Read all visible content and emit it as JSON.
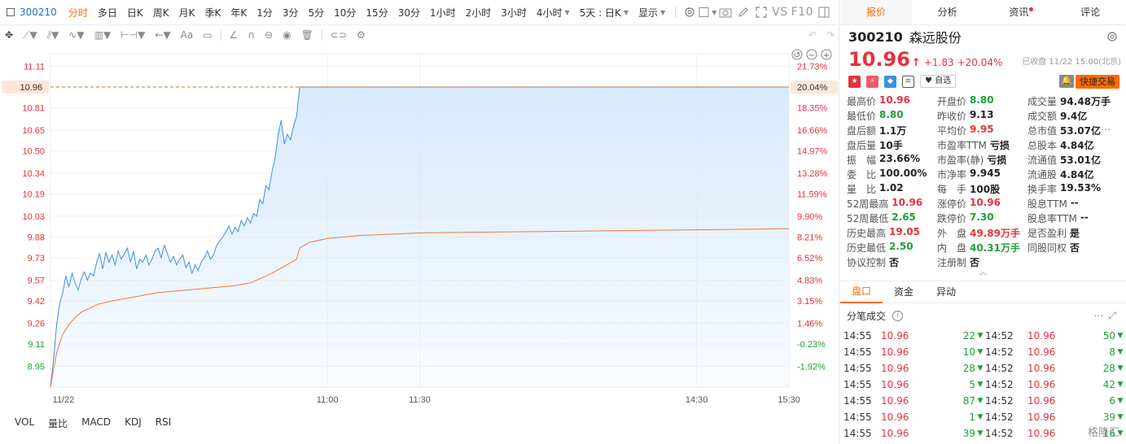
{
  "toolbar": {
    "code": "300210",
    "periods": [
      "分时",
      "多日",
      "日K",
      "周K",
      "月K",
      "季K",
      "年K",
      "1分",
      "3分",
      "5分",
      "10分",
      "15分",
      "30分",
      "1小时",
      "2小时",
      "3小时",
      "4小时"
    ],
    "active_period": "分时",
    "dropdown_period": "4小时",
    "five_day": "5天 : 日K",
    "display": "显示",
    "vs": "VS",
    "f10": "F10"
  },
  "drawtools": {
    "text_label": "Aa"
  },
  "chart_data": {
    "type": "line",
    "subtype": "intraday",
    "prev_close": 9.13,
    "limit_price": 10.96,
    "y_ticks": [
      11.11,
      10.96,
      10.81,
      10.65,
      10.5,
      10.34,
      10.19,
      10.03,
      9.88,
      9.73,
      9.57,
      9.42,
      9.26,
      9.11,
      8.95
    ],
    "y_tick_labels": [
      "11.11",
      "10.96",
      "10.81",
      "10.65",
      "10.50",
      "10.34",
      "10.19",
      "10.03",
      "9.88",
      "9.73",
      "9.57",
      "9.42",
      "9.26",
      "9.11",
      "8.95"
    ],
    "pct_ticks": [
      "21.73%",
      "20.04%",
      "18.35%",
      "16.66%",
      "14.97%",
      "13.28%",
      "11.59%",
      "9.90%",
      "8.21%",
      "6.52%",
      "4.83%",
      "3.15%",
      "1.46%",
      "-0.23%",
      "-1.92%"
    ],
    "highlight_label": "10.96",
    "highlight_pct": "20.04%",
    "ylim": [
      8.8,
      11.2
    ],
    "x_labels": [
      {
        "t": 0,
        "label": "11/22"
      },
      {
        "t": 90,
        "label": "11:00"
      },
      {
        "t": 120,
        "label": "11:30"
      },
      {
        "t": 210,
        "label": "14:30"
      },
      {
        "t": 240,
        "label": "15:30"
      }
    ],
    "x_range": [
      0,
      240
    ],
    "price_series": [
      [
        0,
        8.8
      ],
      [
        1,
        9.0
      ],
      [
        2,
        9.25
      ],
      [
        3,
        9.4
      ],
      [
        4,
        9.48
      ],
      [
        5,
        9.6
      ],
      [
        6,
        9.52
      ],
      [
        7,
        9.62
      ],
      [
        8,
        9.55
      ],
      [
        9,
        9.5
      ],
      [
        10,
        9.58
      ],
      [
        11,
        9.63
      ],
      [
        12,
        9.57
      ],
      [
        13,
        9.62
      ],
      [
        14,
        9.6
      ],
      [
        15,
        9.7
      ],
      [
        16,
        9.76
      ],
      [
        17,
        9.65
      ],
      [
        18,
        9.77
      ],
      [
        19,
        9.7
      ],
      [
        20,
        9.75
      ],
      [
        21,
        9.68
      ],
      [
        22,
        9.78
      ],
      [
        23,
        9.72
      ],
      [
        24,
        9.76
      ],
      [
        25,
        9.8
      ],
      [
        26,
        9.7
      ],
      [
        27,
        9.78
      ],
      [
        28,
        9.65
      ],
      [
        29,
        9.72
      ],
      [
        30,
        9.7
      ],
      [
        31,
        9.75
      ],
      [
        32,
        9.68
      ],
      [
        33,
        9.72
      ],
      [
        34,
        9.78
      ],
      [
        35,
        9.8
      ],
      [
        36,
        9.73
      ],
      [
        37,
        9.82
      ],
      [
        38,
        9.76
      ],
      [
        39,
        9.7
      ],
      [
        40,
        9.74
      ],
      [
        41,
        9.68
      ],
      [
        42,
        9.72
      ],
      [
        43,
        9.75
      ],
      [
        44,
        9.66
      ],
      [
        45,
        9.7
      ],
      [
        46,
        9.62
      ],
      [
        47,
        9.68
      ],
      [
        48,
        9.64
      ],
      [
        49,
        9.7
      ],
      [
        50,
        9.73
      ],
      [
        51,
        9.78
      ],
      [
        52,
        9.72
      ],
      [
        53,
        9.75
      ],
      [
        54,
        9.82
      ],
      [
        55,
        9.85
      ],
      [
        56,
        9.88
      ],
      [
        57,
        9.92
      ],
      [
        58,
        9.96
      ],
      [
        59,
        9.9
      ],
      [
        60,
        9.95
      ],
      [
        61,
        9.92
      ],
      [
        62,
        10.0
      ],
      [
        63,
        9.96
      ],
      [
        64,
        10.02
      ],
      [
        65,
        9.98
      ],
      [
        66,
        10.05
      ],
      [
        67,
        10.03
      ],
      [
        68,
        10.15
      ],
      [
        69,
        10.12
      ],
      [
        70,
        10.25
      ],
      [
        71,
        10.22
      ],
      [
        72,
        10.35
      ],
      [
        73,
        10.45
      ],
      [
        74,
        10.62
      ],
      [
        75,
        10.72
      ],
      [
        76,
        10.55
      ],
      [
        77,
        10.62
      ],
      [
        78,
        10.58
      ],
      [
        79,
        10.68
      ],
      [
        80,
        10.75
      ],
      [
        81,
        10.96
      ],
      [
        240,
        10.96
      ]
    ],
    "avg_series": [
      [
        0,
        8.8
      ],
      [
        2,
        9.05
      ],
      [
        4,
        9.18
      ],
      [
        6,
        9.25
      ],
      [
        8,
        9.3
      ],
      [
        10,
        9.34
      ],
      [
        13,
        9.37
      ],
      [
        16,
        9.4
      ],
      [
        20,
        9.42
      ],
      [
        25,
        9.44
      ],
      [
        30,
        9.46
      ],
      [
        35,
        9.48
      ],
      [
        40,
        9.49
      ],
      [
        45,
        9.5
      ],
      [
        50,
        9.51
      ],
      [
        55,
        9.52
      ],
      [
        60,
        9.53
      ],
      [
        65,
        9.55
      ],
      [
        68,
        9.58
      ],
      [
        72,
        9.62
      ],
      [
        76,
        9.67
      ],
      [
        80,
        9.72
      ],
      [
        81,
        9.8
      ],
      [
        84,
        9.84
      ],
      [
        90,
        9.87
      ],
      [
        100,
        9.89
      ],
      [
        120,
        9.91
      ],
      [
        160,
        9.92
      ],
      [
        200,
        9.93
      ],
      [
        240,
        9.94
      ]
    ],
    "colors": {
      "price_line": "#3d8fe6",
      "area_fill": "#d6e8fb",
      "avg_line": "#f07a3a",
      "up": "#e5323d",
      "down": "#1aa23b",
      "highlight": "#ff6a00"
    }
  },
  "indicators": [
    "VOL",
    "量比",
    "MACD",
    "KDJ",
    "RSI"
  ],
  "panel": {
    "tabs": [
      "报价",
      "分析",
      "资讯",
      "评论"
    ],
    "active_tab": "报价",
    "code": "300210",
    "name": "森远股份",
    "price": "10.96",
    "change": "+1.83",
    "change_pct": "+20.04%",
    "status": "已收盘 11/22 15:00(北京)",
    "zixuan": "自选",
    "quick_trade": "快捷交易",
    "stats": [
      [
        {
          "k": "最高价",
          "v": "10.96",
          "c": "red"
        },
        {
          "k": "开盘价",
          "v": "8.80",
          "c": "green"
        },
        {
          "k": "成交量",
          "v": "94.48万手",
          "c": ""
        }
      ],
      [
        {
          "k": "最低价",
          "v": "8.80",
          "c": "green"
        },
        {
          "k": "昨收价",
          "v": "9.13",
          "c": ""
        },
        {
          "k": "成交额",
          "v": "9.4亿",
          "c": ""
        }
      ],
      [
        {
          "k": "盘后额",
          "v": "1.1万",
          "c": ""
        },
        {
          "k": "平均价",
          "v": "9.95",
          "c": "red"
        },
        {
          "k": "总市值",
          "v": "53.07亿",
          "c": ""
        }
      ],
      [
        {
          "k": "盘后量",
          "v": "10手",
          "c": ""
        },
        {
          "k": "市盈率TTM",
          "v": "亏损",
          "c": ""
        },
        {
          "k": "总股本",
          "v": "4.84亿",
          "c": ""
        }
      ],
      [
        {
          "k": "振　幅",
          "v": "23.66%",
          "c": ""
        },
        {
          "k": "市盈率(静)",
          "v": "亏损",
          "c": ""
        },
        {
          "k": "流通值",
          "v": "53.01亿",
          "c": ""
        }
      ],
      [
        {
          "k": "委　比",
          "v": "100.00%",
          "c": ""
        },
        {
          "k": "市净率",
          "v": "9.945",
          "c": ""
        },
        {
          "k": "流通股",
          "v": "4.84亿",
          "c": ""
        }
      ],
      [
        {
          "k": "量　比",
          "v": "1.02",
          "c": ""
        },
        {
          "k": "每　手",
          "v": "100股",
          "c": ""
        },
        {
          "k": "换手率",
          "v": "19.53%",
          "c": ""
        }
      ],
      [
        {
          "k": "52周最高",
          "v": "10.96",
          "c": "red"
        },
        {
          "k": "涨停价",
          "v": "10.96",
          "c": "red"
        },
        {
          "k": "股息TTM",
          "v": "--",
          "c": ""
        }
      ],
      [
        {
          "k": "52周最低",
          "v": "2.65",
          "c": "green"
        },
        {
          "k": "跌停价",
          "v": "7.30",
          "c": "green"
        },
        {
          "k": "股息率TTM",
          "v": "--",
          "c": ""
        }
      ],
      [
        {
          "k": "历史最高",
          "v": "19.05",
          "c": "red"
        },
        {
          "k": "外　盘",
          "v": "49.89万手",
          "c": "red"
        },
        {
          "k": "是否盈利",
          "v": "是",
          "c": ""
        }
      ],
      [
        {
          "k": "历史最低",
          "v": "2.50",
          "c": "green"
        },
        {
          "k": "内　盘",
          "v": "40.31万手",
          "c": "green"
        },
        {
          "k": "同股同权",
          "v": "否",
          "c": ""
        }
      ],
      [
        {
          "k": "协议控制",
          "v": "否",
          "c": ""
        },
        {
          "k": "注册制",
          "v": "否",
          "c": ""
        },
        {
          "k": "",
          "v": "",
          "c": ""
        }
      ]
    ],
    "subtabs": [
      "盘口",
      "资金",
      "异动"
    ],
    "active_subtab": "盘口",
    "ticks_title": "分笔成交",
    "ticks": [
      {
        "t1": "14:55",
        "p1": "10.96",
        "v1": "22",
        "t2": "14:52",
        "p2": "10.96",
        "v2": "50"
      },
      {
        "t1": "14:55",
        "p1": "10.96",
        "v1": "10",
        "t2": "14:52",
        "p2": "10.96",
        "v2": "8"
      },
      {
        "t1": "14:55",
        "p1": "10.96",
        "v1": "28",
        "t2": "14:52",
        "p2": "10.96",
        "v2": "28"
      },
      {
        "t1": "14:55",
        "p1": "10.96",
        "v1": "5",
        "t2": "14:52",
        "p2": "10.96",
        "v2": "42"
      },
      {
        "t1": "14:55",
        "p1": "10.96",
        "v1": "87",
        "t2": "14:52",
        "p2": "10.96",
        "v2": "6"
      },
      {
        "t1": "14:55",
        "p1": "10.96",
        "v1": "1",
        "t2": "14:52",
        "p2": "10.96",
        "v2": "39"
      },
      {
        "t1": "14:55",
        "p1": "10.96",
        "v1": "39",
        "t2": "14:52",
        "p2": "10.96",
        "v2": "16"
      }
    ]
  },
  "watermark": "格隆汇"
}
